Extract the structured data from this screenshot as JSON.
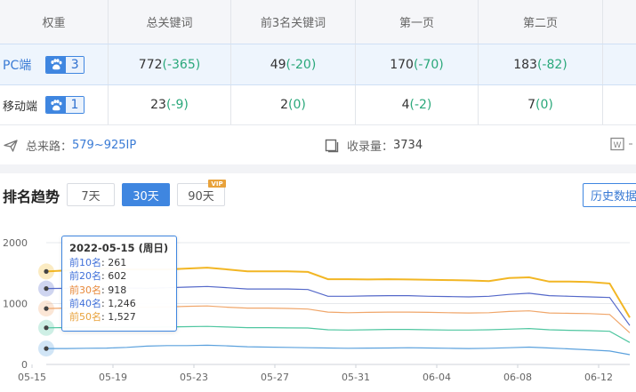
{
  "table": {
    "headers": [
      "权重",
      "总关键词",
      "前3名关键词",
      "第一页",
      "第二页"
    ],
    "rows": [
      {
        "label": "PC端",
        "weight": "3",
        "total": "772",
        "total_delta": "(-365)",
        "top3": "49",
        "top3_delta": "(-20)",
        "page1": "170",
        "page1_delta": "(-70)",
        "page2": "183",
        "page2_delta": "(-82)"
      },
      {
        "label": "移动端",
        "weight": "1",
        "total": "23",
        "total_delta": "(-9)",
        "top3": "2",
        "top3_delta": "(0)",
        "page1": "4",
        "page1_delta": "(-2)",
        "page2": "7",
        "page2_delta": "(0)"
      }
    ],
    "weight_icon": "baidu-paw-icon"
  },
  "summary": {
    "traffic_label": "总来路：",
    "traffic_value": "579~925IP",
    "indexed_label": "收录量：",
    "indexed_value": "3734",
    "icons": [
      "send-icon",
      "page-icon",
      "word-doc-icon"
    ]
  },
  "trend": {
    "title": "排名趋势",
    "ranges": [
      "7天",
      "30天",
      "90天"
    ],
    "active_range": "30天",
    "vip_badge": "VIP",
    "history_button": "历史数据"
  },
  "tooltip": {
    "date": "2022-05-15 (周日)",
    "rows": [
      {
        "label": "前10名",
        "value": "261",
        "color": "#3f6fd8"
      },
      {
        "label": "前20名",
        "value": "602",
        "color": "#3f6fd8"
      },
      {
        "label": "前30名",
        "value": "918",
        "color": "#e8893a"
      },
      {
        "label": "前40名",
        "value": "1,246",
        "color": "#3f6fd8"
      },
      {
        "label": "前50名",
        "value": "1,527",
        "color": "#e8a23b"
      }
    ]
  },
  "chart_data": {
    "type": "line",
    "ylim": [
      0,
      2000
    ],
    "yticks": [
      0,
      1000,
      2000
    ],
    "xtick_labels": [
      "05-15",
      "05-19",
      "05-23",
      "05-27",
      "05-31",
      "06-04",
      "06-08",
      "06-12"
    ],
    "categories": [
      "05-15",
      "05-16",
      "05-17",
      "05-18",
      "05-19",
      "05-20",
      "05-21",
      "05-22",
      "05-23",
      "05-24",
      "05-25",
      "05-26",
      "05-27",
      "05-28",
      "05-29",
      "05-30",
      "05-31",
      "06-01",
      "06-02",
      "06-03",
      "06-04",
      "06-05",
      "06-06",
      "06-07",
      "06-08",
      "06-09",
      "06-10",
      "06-11",
      "06-12",
      "06-13"
    ],
    "series": [
      {
        "name": "前50名",
        "color": "#f2b624",
        "values": [
          1527,
          1545,
          1560,
          1575,
          1560,
          1560,
          1560,
          1575,
          1590,
          1560,
          1530,
          1530,
          1530,
          1520,
          1400,
          1400,
          1395,
          1400,
          1395,
          1390,
          1385,
          1380,
          1370,
          1420,
          1430,
          1360,
          1360,
          1355,
          1330,
          770
        ]
      },
      {
        "name": "前40名",
        "color": "#5468c9",
        "values": [
          1246,
          1250,
          1258,
          1260,
          1255,
          1250,
          1260,
          1270,
          1280,
          1260,
          1240,
          1240,
          1240,
          1230,
          1120,
          1120,
          1125,
          1130,
          1130,
          1120,
          1115,
          1110,
          1120,
          1150,
          1170,
          1130,
          1120,
          1110,
          1100,
          640
        ]
      },
      {
        "name": "前30名",
        "color": "#f0a66a",
        "values": [
          918,
          925,
          930,
          935,
          940,
          940,
          945,
          955,
          960,
          940,
          925,
          925,
          920,
          910,
          860,
          850,
          855,
          860,
          860,
          855,
          850,
          845,
          850,
          870,
          880,
          845,
          840,
          835,
          820,
          520
        ]
      },
      {
        "name": "前20名",
        "color": "#4fc6a0",
        "values": [
          602,
          606,
          610,
          612,
          610,
          610,
          615,
          620,
          625,
          615,
          605,
          605,
          600,
          598,
          570,
          565,
          570,
          575,
          575,
          570,
          565,
          565,
          570,
          580,
          590,
          570,
          560,
          555,
          545,
          360
        ]
      },
      {
        "name": "前10名",
        "color": "#5ba1dd",
        "values": [
          261,
          262,
          265,
          268,
          280,
          300,
          310,
          310,
          315,
          305,
          290,
          285,
          280,
          275,
          270,
          265,
          268,
          270,
          275,
          270,
          265,
          262,
          265,
          275,
          285,
          270,
          255,
          240,
          220,
          160
        ]
      }
    ]
  }
}
